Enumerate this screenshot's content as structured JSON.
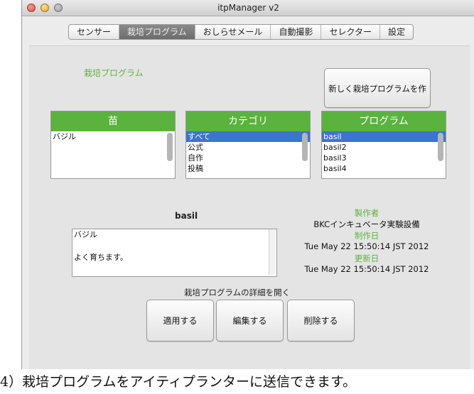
{
  "window": {
    "title": "itpManager v2"
  },
  "tabs": [
    {
      "label": "センサー",
      "active": false
    },
    {
      "label": "栽培プログラム",
      "active": true
    },
    {
      "label": "おしらせメール",
      "active": false
    },
    {
      "label": "自動撮影",
      "active": false
    },
    {
      "label": "セレクター",
      "active": false
    },
    {
      "label": "設定",
      "active": false
    }
  ],
  "section": {
    "title": "栽培プログラム",
    "new_button": "新しく栽培プログラムを作る"
  },
  "lists": {
    "seedling": {
      "header": "苗",
      "items": [
        "バジル"
      ],
      "selected": -1
    },
    "category": {
      "header": "カテゴリ",
      "items": [
        "すべて",
        "公式",
        "自作",
        "投稿"
      ],
      "selected": 0
    },
    "program": {
      "header": "プログラム",
      "items": [
        "basil",
        "basil2",
        "basil3",
        "basil4"
      ],
      "selected": 0
    }
  },
  "detail": {
    "name": "basil",
    "description": [
      "バジル",
      "",
      "よく育ちます。"
    ],
    "maker_label": "製作者",
    "maker": "BKCインキュベータ実験設備",
    "created_label": "制作日",
    "created": "Tue May 22 15:50:14 JST 2012",
    "updated_label": "更新日",
    "updated": "Tue May 22 15:50:14 JST 2012",
    "open_detail": "栽培プログラムの詳細を開く"
  },
  "actions": {
    "apply": "適用する",
    "edit": "編集する",
    "delete": "削除する"
  },
  "colors": {
    "accent_green": "#59b33c",
    "selection_blue": "#3b74d3"
  },
  "caption": "4）栽培プログラムをアイティプランターに送信できます。"
}
